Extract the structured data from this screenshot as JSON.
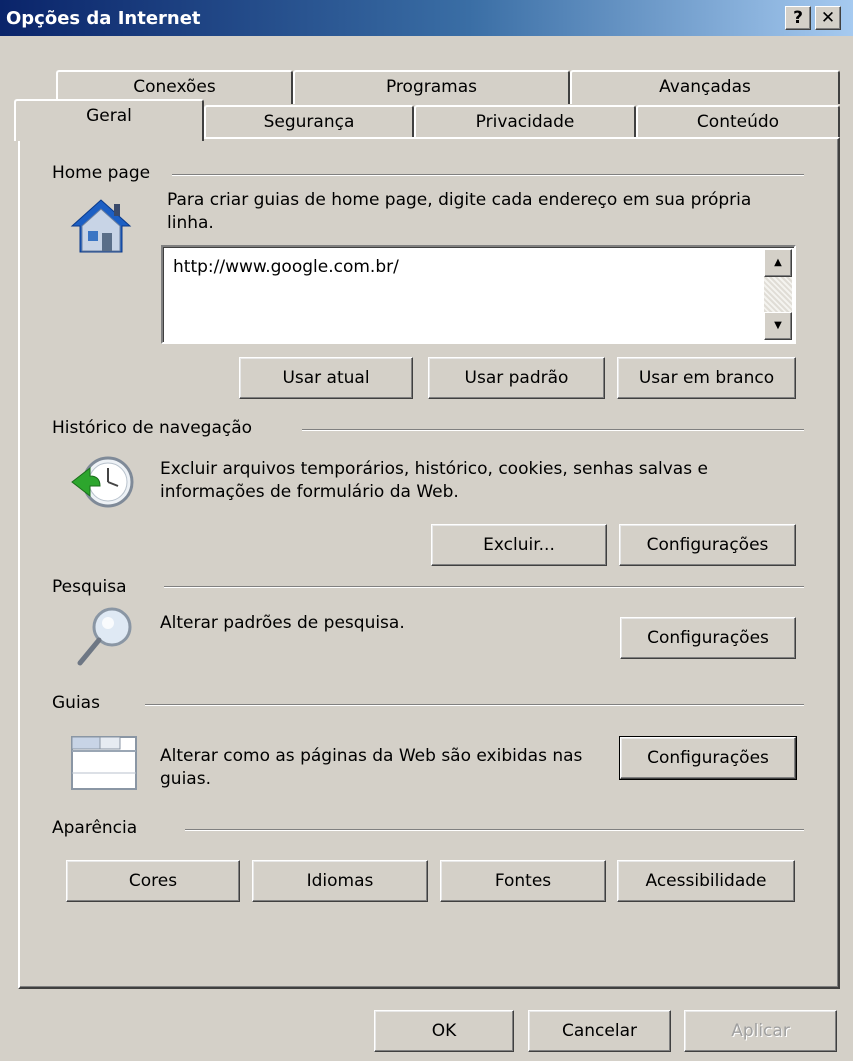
{
  "window": {
    "title": "Opções da Internet",
    "help_button": "?",
    "close_button": "✕"
  },
  "tabs_back": [
    {
      "label": "Conexões"
    },
    {
      "label": "Programas"
    },
    {
      "label": "Avançadas"
    }
  ],
  "tabs_front": [
    {
      "label": "Geral",
      "active": true
    },
    {
      "label": "Segurança"
    },
    {
      "label": "Privacidade"
    },
    {
      "label": "Conteúdo"
    }
  ],
  "home_page": {
    "heading": "Home page",
    "icon": "home-icon",
    "description": "Para criar guias de home page, digite cada endereço em sua própria linha.",
    "url_value": "http://www.google.com.br/",
    "buttons": {
      "use_current": "Usar atual",
      "use_default": "Usar padrão",
      "use_blank": "Usar em branco"
    }
  },
  "history": {
    "heading": "Histórico de navegação",
    "icon": "history-clock-icon",
    "description": "Excluir arquivos temporários, histórico, cookies, senhas salvas e informações de formulário da Web.",
    "buttons": {
      "delete": "Excluir...",
      "settings": "Configurações"
    }
  },
  "search": {
    "heading": "Pesquisa",
    "icon": "magnifier-icon",
    "description": "Alterar padrões de pesquisa.",
    "buttons": {
      "settings": "Configurações"
    }
  },
  "tabs_section": {
    "heading": "Guias",
    "icon": "tabs-window-icon",
    "description": "Alterar como as páginas da Web são exibidas nas guias.",
    "buttons": {
      "settings": "Configurações"
    }
  },
  "appearance": {
    "heading": "Aparência",
    "buttons": {
      "colors": "Cores",
      "languages": "Idiomas",
      "fonts": "Fontes",
      "accessibility": "Acessibilidade"
    }
  },
  "footer": {
    "ok": "OK",
    "cancel": "Cancelar",
    "apply": "Aplicar"
  },
  "colors": {
    "titlebar_start": "#0a246a",
    "titlebar_end": "#a6caf0",
    "face": "#d4d0c8"
  }
}
